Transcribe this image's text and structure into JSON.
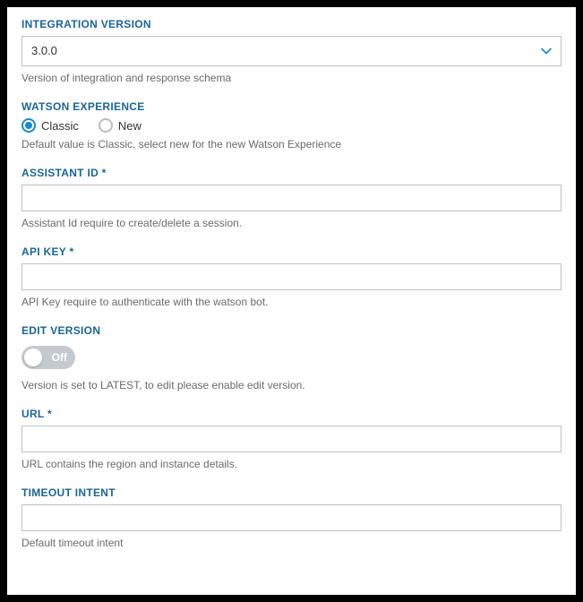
{
  "integrationVersion": {
    "label": "INTEGRATION VERSION",
    "value": "3.0.0",
    "helper": "Version of integration and response schema"
  },
  "watsonExperience": {
    "label": "WATSON EXPERIENCE",
    "options": [
      {
        "label": "Classic",
        "checked": true
      },
      {
        "label": "New",
        "checked": false
      }
    ],
    "helper": "Default value is Classic, select new for the new Watson Experience"
  },
  "assistantId": {
    "label": "ASSISTANT ID *",
    "value": "",
    "helper": "Assistant Id require to create/delete a session."
  },
  "apiKey": {
    "label": "API KEY *",
    "value": "",
    "helper": "API Key require to authenticate with the watson bot."
  },
  "editVersion": {
    "label": "EDIT VERSION",
    "state": "Off",
    "helper": "Version is set to LATEST, to edit please enable edit version."
  },
  "url": {
    "label": "URL *",
    "value": "",
    "helper": "URL contains the region and instance details."
  },
  "timeoutIntent": {
    "label": "TIMEOUT INTENT",
    "value": "",
    "helper": "Default timeout intent"
  }
}
